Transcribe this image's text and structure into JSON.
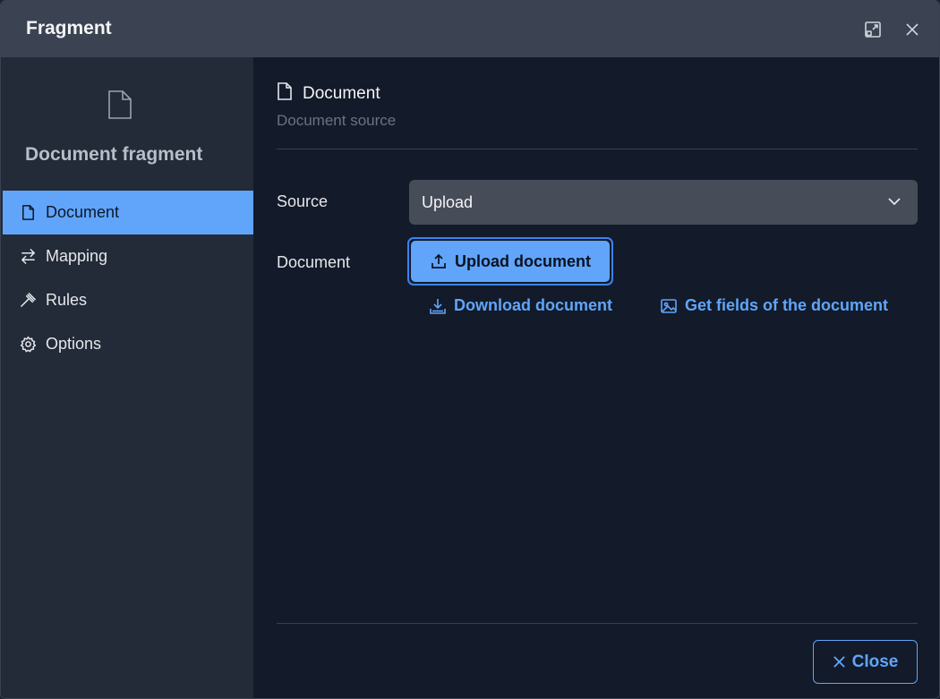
{
  "window": {
    "title": "Fragment",
    "maximize_icon": "restore-window-icon",
    "close_icon": "close-icon"
  },
  "sidebar": {
    "header_icon": "document-icon",
    "title": "Document fragment",
    "items": [
      {
        "label": "Document",
        "icon": "document-icon",
        "active": true
      },
      {
        "label": "Mapping",
        "icon": "arrows-swap-icon",
        "active": false
      },
      {
        "label": "Rules",
        "icon": "gavel-icon",
        "active": false
      },
      {
        "label": "Options",
        "icon": "gear-icon",
        "active": false
      }
    ]
  },
  "main": {
    "section_title": "Document",
    "section_subtitle": "Document source",
    "source_label": "Source",
    "source_value": "Upload",
    "document_label": "Document",
    "upload_button": "Upload document",
    "download_link": "Download document",
    "fields_link": "Get fields of the document"
  },
  "footer": {
    "close_label": "Close"
  },
  "colors": {
    "accent": "#60a5fa",
    "titlebar": "#3b4352",
    "sidebar": "#232a38",
    "background": "#131a29"
  }
}
